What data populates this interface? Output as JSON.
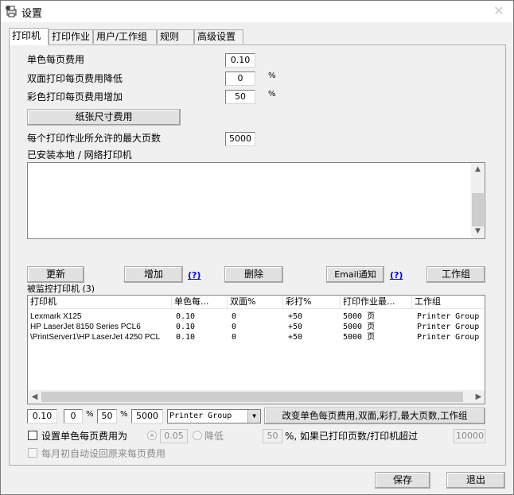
{
  "window": {
    "title": "设置",
    "close_glyph": "✕"
  },
  "tabs": [
    "打印机",
    "打印作业",
    "用户/工作组",
    "规则",
    "高级设置"
  ],
  "costs": {
    "mono_label": "单色每页费用",
    "mono_value": "0.10",
    "duplex_label": "双面打印每页费用降低",
    "duplex_value": "0",
    "color_label": "彩色打印每页费用增加",
    "color_value": "50",
    "percent": "%",
    "paper_size_button": "纸张尺寸费用",
    "max_pages_label": "每个打印作业所允许的最大页数",
    "max_pages_value": "5000"
  },
  "installed": {
    "label": "已安装本地 / 网络打印机"
  },
  "buttons": {
    "refresh": "更新",
    "add": "增加",
    "add_help": "(?)",
    "delete": "删除",
    "email": "Email通知",
    "email_help": "(?)",
    "workgroup": "工作组",
    "save": "保存",
    "exit": "退出"
  },
  "monitored": {
    "label": "被监控打印机 (3)",
    "columns": [
      "打印机",
      "单色每...",
      "双面%",
      "彩打%",
      "打印作业最...",
      "工作组"
    ],
    "rows": [
      [
        "Lexmark X125",
        "0.10",
        "0",
        "+50",
        "5000 页",
        "Printer Group"
      ],
      [
        "HP LaserJet 8150 Series PCL6",
        "0.10",
        "0",
        "+50",
        "5000 页",
        "Printer Group"
      ],
      [
        "\\PrintServer1\\HP LaserJet 4250 PCL",
        "0.10",
        "0",
        "+50",
        "5000 页",
        "Printer Group"
      ]
    ]
  },
  "edit_row": {
    "mono": "0.10",
    "duplex": "0",
    "pct1": "%",
    "color": "50",
    "pct2": "%",
    "max_pages": "5000",
    "group": "Printer Group",
    "apply_button": "改变单色每页费用,双面,彩打,最大页数,工作组"
  },
  "options": {
    "set_cost_label": "设置单色每页费用为",
    "set_cost_value": "0.05",
    "reduce_label": "降低",
    "reduce_value": "50",
    "reduce_suffix": "%, 如果已打印页数/打印机超过",
    "threshold_value": "10000",
    "reset_label": "每月初自动设回原来每页费用"
  }
}
